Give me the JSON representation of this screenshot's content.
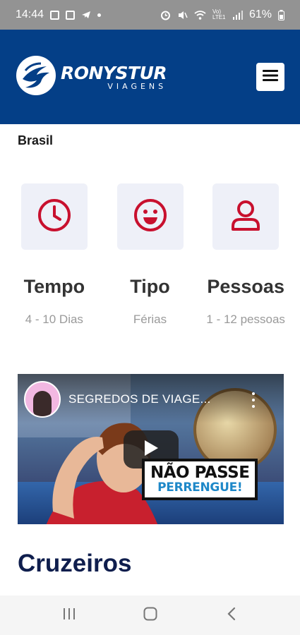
{
  "status_bar": {
    "time": "14:44",
    "battery": "61%",
    "network_label": "Vo) LTE1"
  },
  "header": {
    "brand_name": "RONYSTUR",
    "brand_sub": "VIAGENS",
    "colors": {
      "background": "#043f87",
      "accent": "#c8102e"
    }
  },
  "breadcrumb": "Brasil",
  "features": [
    {
      "title": "Tempo",
      "value": "4 - 10 Dias",
      "icon": "clock-icon"
    },
    {
      "title": "Tipo",
      "value": "Férias",
      "icon": "smile-icon"
    },
    {
      "title": "Pessoas",
      "value": "1 - 12 pessoas",
      "icon": "user-icon"
    }
  ],
  "video": {
    "title": "SEGREDOS DE VIAGE...",
    "caption_line1": "NÃO PASSE",
    "caption_line2": "PERRENGUE!"
  },
  "section": {
    "heading": "Cruzeiros"
  }
}
